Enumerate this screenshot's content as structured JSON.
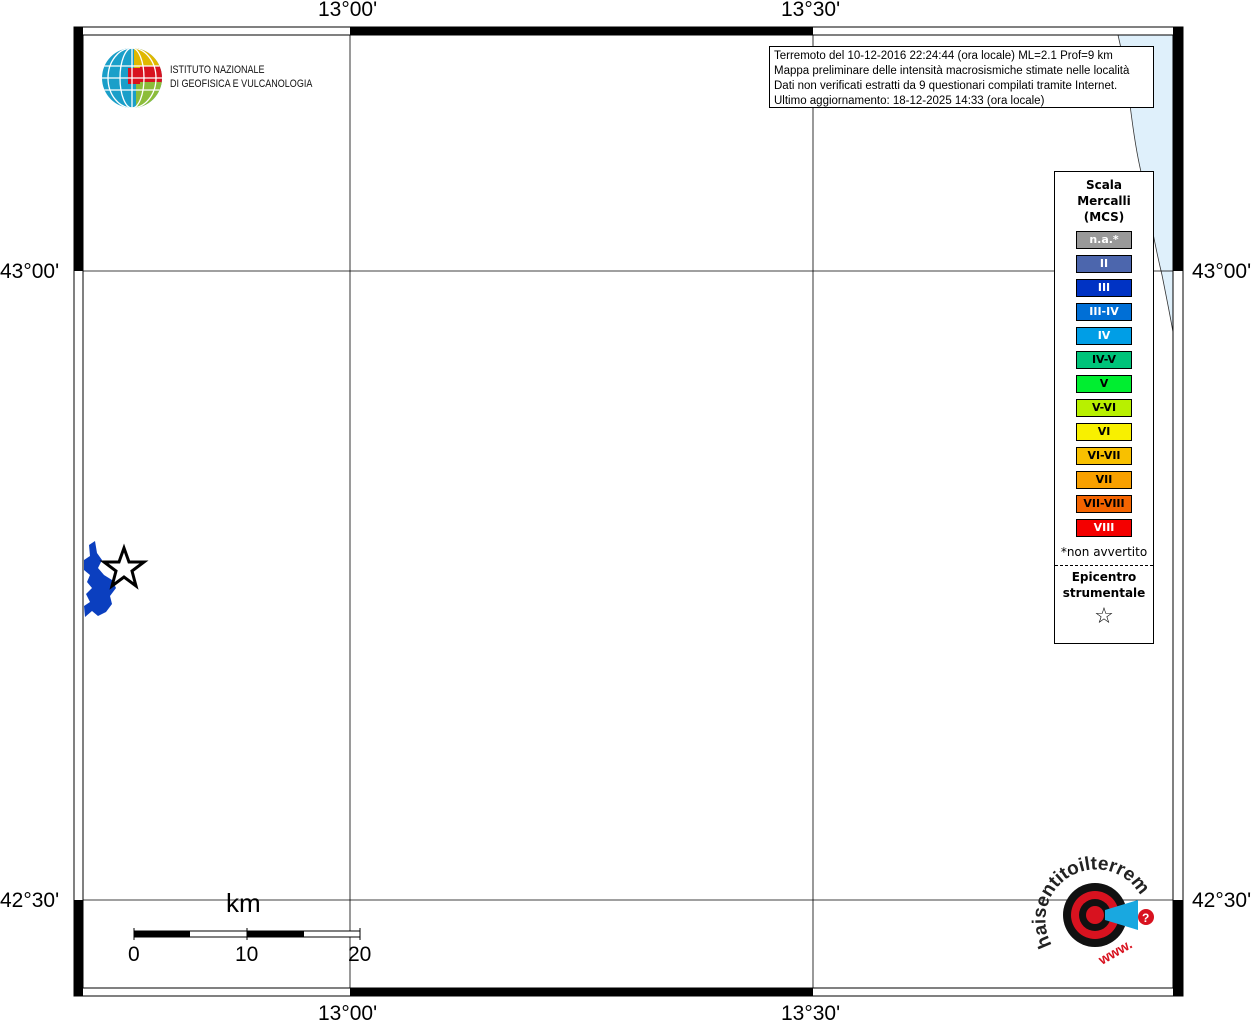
{
  "map": {
    "lon_labels": [
      "13°00'",
      "13°30'"
    ],
    "lat_labels": [
      "43°00'",
      "42°30'"
    ],
    "colors": {
      "sea": "#dff0fb",
      "lake": "#0b3fbf",
      "grid": "#000000"
    }
  },
  "info": {
    "line1": "Terremoto del 10-12-2016 22:24:44 (ora locale) ML=2.1 Prof=9 km",
    "line2": "Mappa preliminare delle intensità macrosismiche stimate nelle località",
    "line3": "Dati non verificati estratti da 9 questionari compilati tramite Internet.",
    "line4": "Ultimo aggiornamento: 18-12-2025 14:33 (ora locale)"
  },
  "logo": {
    "line1": "ISTITUTO NAZIONALE",
    "line2": "DI GEOFISICA E VULCANOLOGIA"
  },
  "legend": {
    "title1": "Scala",
    "title2": "Mercalli",
    "title3": "(MCS)",
    "items": [
      {
        "label": "n.a.*",
        "color": "#999999",
        "text_color": "#ffffff"
      },
      {
        "label": "II",
        "color": "#4c66ad",
        "text_color": "#ffffff"
      },
      {
        "label": "III",
        "color": "#0033c4",
        "text_color": "#ffffff"
      },
      {
        "label": "III-IV",
        "color": "#006fd6",
        "text_color": "#ffffff"
      },
      {
        "label": "IV",
        "color": "#009ee6",
        "text_color": "#ffffff"
      },
      {
        "label": "IV-V",
        "color": "#00c47a",
        "text_color": "#000000"
      },
      {
        "label": "V",
        "color": "#00ee30",
        "text_color": "#000000"
      },
      {
        "label": "V-VI",
        "color": "#b8f000",
        "text_color": "#000000"
      },
      {
        "label": "VI",
        "color": "#f8f000",
        "text_color": "#000000"
      },
      {
        "label": "VI-VII",
        "color": "#f8c000",
        "text_color": "#000000"
      },
      {
        "label": "VII",
        "color": "#f8a000",
        "text_color": "#000000"
      },
      {
        "label": "VII-VIII",
        "color": "#f46400",
        "text_color": "#000000"
      },
      {
        "label": "VIII",
        "color": "#f40000",
        "text_color": "#ffffff"
      }
    ],
    "note": "*non avvertito",
    "epi1": "Epicentro",
    "epi2": "strumentale",
    "epi_symbol": "☆"
  },
  "scale": {
    "unit": "km",
    "labels": [
      "0",
      "10",
      "20"
    ]
  },
  "site_logo": {
    "ring_text": "haisentitoilterremoto.it",
    "www": "www."
  }
}
